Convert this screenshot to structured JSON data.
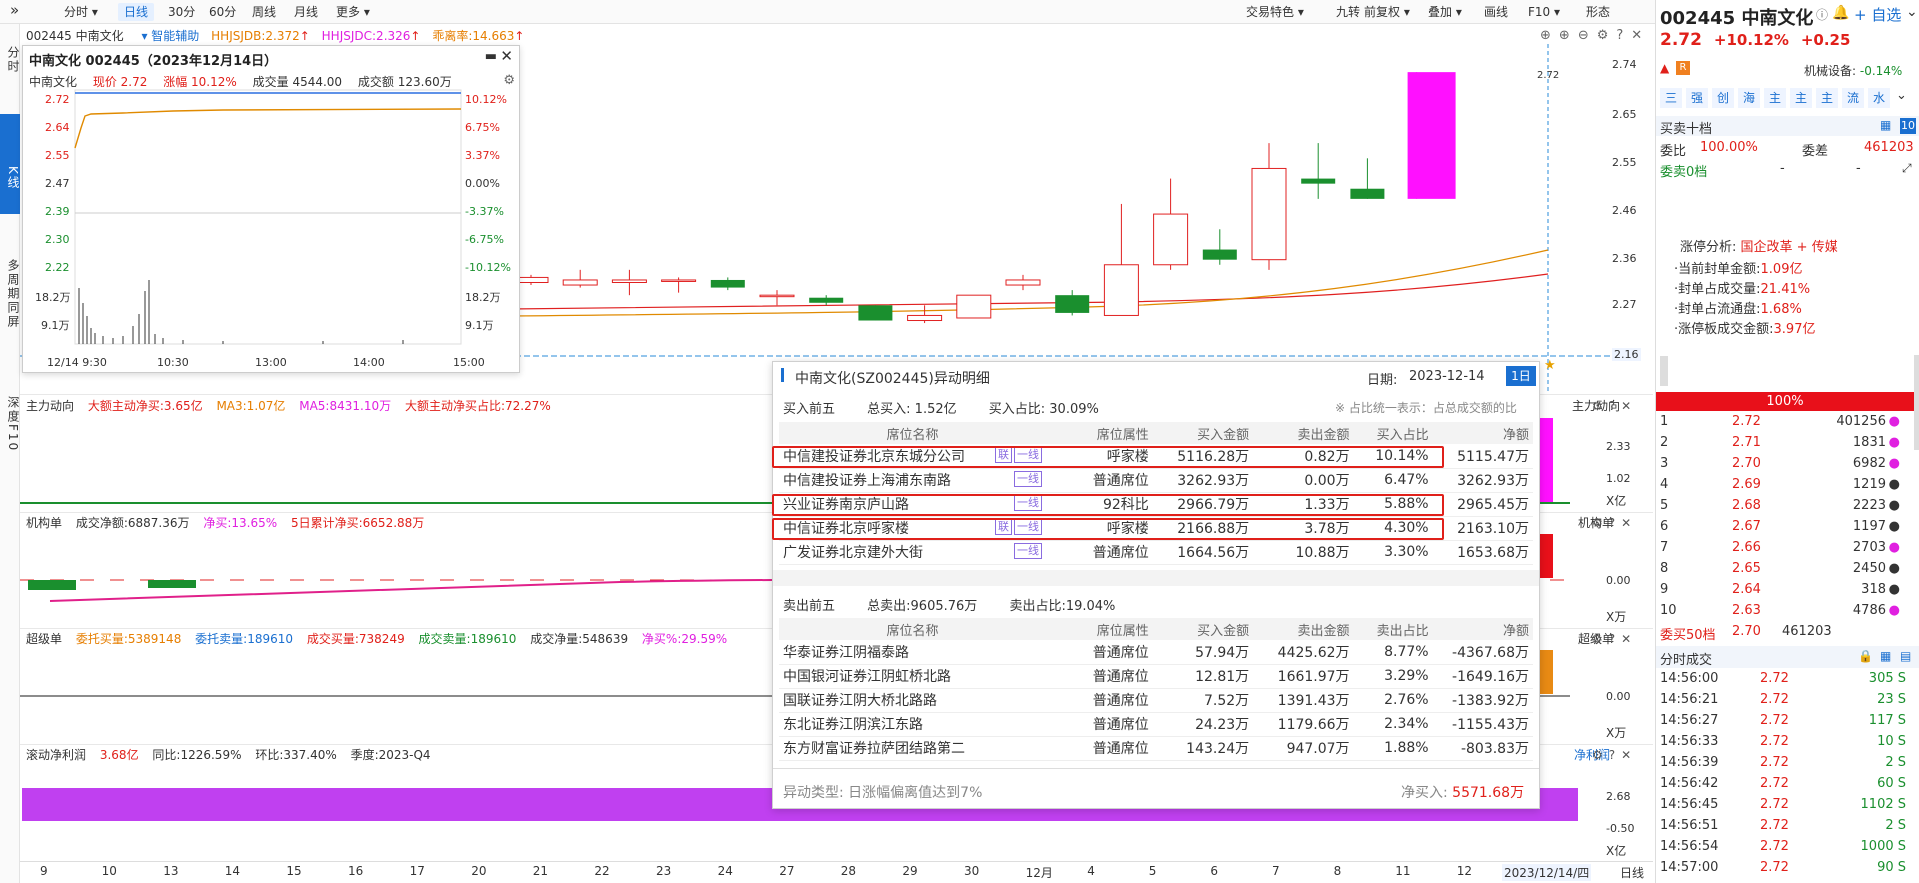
{
  "toolbar": {
    "left": [
      "分时",
      "日线",
      "30分",
      "60分",
      "周线",
      "月线",
      "更多"
    ],
    "right": [
      "交易特色",
      "九转",
      "前复权",
      "叠加",
      "画线",
      "F10",
      "形态"
    ]
  },
  "left_tabs": [
    "分时",
    "K线",
    "多周期同屏",
    "深度F10"
  ],
  "main_header": {
    "code_name": "002445 中南文化",
    "assist": "智能辅助",
    "hhjsjdb": "HHJSJDB:2.372",
    "hhjsjdc": "HHJSJDC:2.326",
    "deviation": "乖离率:14.663"
  },
  "price_axis": [
    "2.74",
    "2.65",
    "2.55",
    "2.46",
    "2.36",
    "2.27",
    "2.16"
  ],
  "last_price_label": "2.72",
  "x_axis": [
    "9",
    "10",
    "13",
    "14",
    "15",
    "16",
    "17",
    "20",
    "21",
    "22",
    "23",
    "24",
    "27",
    "28",
    "29",
    "30",
    "12月",
    "4",
    "5",
    "6",
    "7",
    "8",
    "11",
    "12"
  ],
  "x_axis_current": "2023/12/14/四",
  "x_axis_period": "日线",
  "mini_chart": {
    "title": "中南文化 002445（2023年12月14日）",
    "name": "中南文化",
    "price": "现价 2.72",
    "change": "涨幅 10.12%",
    "volume": "成交量 4544.00",
    "amount": "成交额 123.60万",
    "left_axis": [
      "2.72",
      "2.64",
      "2.55",
      "2.47",
      "2.39",
      "2.30",
      "2.22",
      "18.2万",
      "9.1万"
    ],
    "right_axis": [
      "10.12%",
      "6.75%",
      "3.37%",
      "0.00%",
      "-3.37%",
      "-6.75%",
      "-10.12%",
      "18.2万",
      "9.1万"
    ],
    "time_axis": [
      "12/14 9:30",
      "10:30",
      "13:00",
      "14:00",
      "15:00"
    ]
  },
  "indicators": {
    "main_force": {
      "label": "主力动向",
      "a": "大额主动净买:3.65亿",
      "b": "MA3:1.07亿",
      "c": "MA5:8431.10万",
      "d": "大额主动净买占比:72.27%",
      "axis": [
        "2.33",
        "1.02",
        "X亿"
      ],
      "side": "主力动向"
    },
    "institution": {
      "label": "机构单",
      "a": "成交净额:6887.36万",
      "b": "净买:13.65%",
      "c": "5日累计净买:6652.88万",
      "axis": [
        "0.00",
        "X万"
      ],
      "side": "机构单"
    },
    "super": {
      "label": "超级单",
      "a": "委托买量:5389148",
      "b": "委托卖量:189610",
      "c": "成交买量:738249",
      "d": "成交卖量:189610",
      "e": "成交净量:548639",
      "f": "净买%:29.59%",
      "axis": [
        "0.00",
        "X万"
      ],
      "side": "超级单"
    },
    "profit": {
      "label": "滚动净利润",
      "a": "3.68亿",
      "b": "同比:1226.59%",
      "c": "环比:337.40%",
      "d": "季度:2023-Q4",
      "axis": [
        "2.68",
        "-0.50",
        "X亿"
      ],
      "side": "净利润"
    }
  },
  "detail": {
    "title": "中南文化(SZ002445)异动明细",
    "date_label": "日期:",
    "date": "2023-12-14",
    "period_btn": "1日",
    "buy_header": {
      "title": "买入前五",
      "total": "总买入: 1.52亿",
      "ratio": "买入占比: 30.09%",
      "note": "※ 占比统一表示：占总成交额的比"
    },
    "columns": [
      "席位名称",
      "席位属性",
      "买入金额",
      "卖出金额",
      "买入占比",
      "净额"
    ],
    "sell_columns": [
      "席位名称",
      "席位属性",
      "买入金额",
      "卖出金额",
      "卖出占比",
      "净额"
    ],
    "buy_rows": [
      {
        "name": "中信建投证券北京东城分公司",
        "tags": [
          "联",
          "一线"
        ],
        "attr": "呼家楼",
        "buy": "5116.28万",
        "sell": "0.82万",
        "ratio": "10.14%",
        "net": "5115.47万"
      },
      {
        "name": "中信建投证券上海浦东南路",
        "tags": [
          "一线"
        ],
        "attr": "普通席位",
        "buy": "3262.93万",
        "sell": "0.00万",
        "ratio": "6.47%",
        "net": "3262.93万"
      },
      {
        "name": "兴业证券南京庐山路",
        "tags": [
          "一线"
        ],
        "attr": "92科比",
        "buy": "2966.79万",
        "sell": "1.33万",
        "ratio": "5.88%",
        "net": "2965.45万"
      },
      {
        "name": "中信证券北京呼家楼",
        "tags": [
          "联",
          "一线"
        ],
        "attr": "呼家楼",
        "buy": "2166.88万",
        "sell": "3.78万",
        "ratio": "4.30%",
        "net": "2163.10万"
      },
      {
        "name": "广发证券北京建外大街",
        "tags": [
          "一线"
        ],
        "attr": "普通席位",
        "buy": "1664.56万",
        "sell": "10.88万",
        "ratio": "3.30%",
        "net": "1653.68万"
      }
    ],
    "sell_header": {
      "title": "卖出前五",
      "total": "总卖出:9605.76万",
      "ratio": "卖出占比:19.04%"
    },
    "sell_rows": [
      {
        "name": "华泰证券江阴福泰路",
        "attr": "普通席位",
        "buy": "57.94万",
        "sell": "4425.62万",
        "ratio": "8.77%",
        "net": "-4367.68万"
      },
      {
        "name": "中国银河证券江阴虹桥北路",
        "attr": "普通席位",
        "buy": "12.81万",
        "sell": "1661.97万",
        "ratio": "3.29%",
        "net": "-1649.16万"
      },
      {
        "name": "国联证券江阴大桥北路路",
        "attr": "普通席位",
        "buy": "7.52万",
        "sell": "1391.43万",
        "ratio": "2.76%",
        "net": "-1383.92万"
      },
      {
        "name": "东北证券江阴滨江东路",
        "attr": "普通席位",
        "buy": "24.23万",
        "sell": "1179.66万",
        "ratio": "2.34%",
        "net": "-1155.43万"
      },
      {
        "name": "东方财富证券拉萨团结路第二",
        "attr": "普通席位",
        "buy": "143.24万",
        "sell": "947.07万",
        "ratio": "1.88%",
        "net": "-803.83万"
      }
    ],
    "footer_type": "异动类型: 日涨幅偏离值达到7%",
    "footer_net_label": "净买入:",
    "footer_net": "5571.68万"
  },
  "right_panel": {
    "code": "002445",
    "name": "中南文化",
    "add_btn": "自选",
    "price": "2.72",
    "change_pct": "+10.12%",
    "change_amt": "+0.25",
    "badge_r": "R",
    "mech_label": "机械设备:",
    "mech_val": "-0.14%",
    "tabs": [
      "三",
      "强",
      "创",
      "海",
      "主",
      "主",
      "主",
      "流",
      "水"
    ],
    "book_title": "买卖十档",
    "book_btn": "10",
    "wb_label": "委比",
    "wb_val": "100.00%",
    "wc_label": "委差",
    "wc_val": "461203",
    "sell0": "委卖0档",
    "sell0_a": "-",
    "sell0_b": "-",
    "zt_label": "涨停分析:",
    "zt_reason": "国企改革 + 传媒",
    "zt_lines": [
      {
        "k": "·当前封单金额:",
        "v": "1.09亿"
      },
      {
        "k": "·封单占成交量:",
        "v": "21.41%"
      },
      {
        "k": "·封单占流通盘:",
        "v": "1.68%"
      },
      {
        "k": "·涨停板成交金额:",
        "v": "3.97亿"
      }
    ],
    "bar_label": "100%",
    "bids": [
      {
        "lvl": "1",
        "p": "2.72",
        "v": "401256",
        "c": "#e020e0"
      },
      {
        "lvl": "2",
        "p": "2.71",
        "v": "1831",
        "c": "#e020e0"
      },
      {
        "lvl": "3",
        "p": "2.70",
        "v": "6982",
        "c": "#e020e0"
      },
      {
        "lvl": "4",
        "p": "2.69",
        "v": "1219",
        "c": "#333333"
      },
      {
        "lvl": "5",
        "p": "2.68",
        "v": "2223",
        "c": "#333333"
      },
      {
        "lvl": "6",
        "p": "2.67",
        "v": "1197",
        "c": "#333333"
      },
      {
        "lvl": "7",
        "p": "2.66",
        "v": "2703",
        "c": "#e020e0"
      },
      {
        "lvl": "8",
        "p": "2.65",
        "v": "2450",
        "c": "#333333"
      },
      {
        "lvl": "9",
        "p": "2.64",
        "v": "318",
        "c": "#333333"
      },
      {
        "lvl": "10",
        "p": "2.63",
        "v": "4786",
        "c": "#e020e0"
      }
    ],
    "buy50_label": "委买50档",
    "buy50_p": "2.70",
    "buy50_v": "461203",
    "ticks_title": "分时成交",
    "ticks": [
      {
        "t": "14:56:00",
        "p": "2.72",
        "v": "305 S"
      },
      {
        "t": "14:56:21",
        "p": "2.72",
        "v": "23 S"
      },
      {
        "t": "14:56:27",
        "p": "2.72",
        "v": "117 S"
      },
      {
        "t": "14:56:33",
        "p": "2.72",
        "v": "10 S"
      },
      {
        "t": "14:56:39",
        "p": "2.72",
        "v": "2 S"
      },
      {
        "t": "14:56:42",
        "p": "2.72",
        "v": "60 S"
      },
      {
        "t": "14:56:45",
        "p": "2.72",
        "v": "1102 S"
      },
      {
        "t": "14:56:51",
        "p": "2.72",
        "v": "2 S"
      },
      {
        "t": "14:56:54",
        "p": "2.72",
        "v": "1000 S"
      },
      {
        "t": "14:57:00",
        "p": "2.72",
        "v": "90 S"
      }
    ]
  },
  "candles": [
    {
      "o": 2.305,
      "c": 2.315,
      "h": 2.32,
      "l": 2.3
    },
    {
      "o": 2.3,
      "c": 2.31,
      "h": 2.33,
      "l": 2.295
    },
    {
      "o": 2.305,
      "c": 2.31,
      "h": 2.33,
      "l": 2.28
    },
    {
      "o": 2.31,
      "c": 2.31,
      "h": 2.315,
      "l": 2.285
    },
    {
      "o": 2.31,
      "c": 2.295,
      "h": 2.315,
      "l": 2.29
    },
    {
      "o": 2.28,
      "c": 2.28,
      "h": 2.29,
      "l": 2.26
    },
    {
      "o": 2.275,
      "c": 2.265,
      "h": 2.28,
      "l": 2.26
    },
    {
      "o": 2.26,
      "c": 2.23,
      "h": 2.26,
      "l": 2.23
    },
    {
      "o": 2.23,
      "c": 2.24,
      "h": 2.26,
      "l": 2.225
    },
    {
      "o": 2.235,
      "c": 2.28,
      "h": 2.28,
      "l": 2.235
    },
    {
      "o": 2.3,
      "c": 2.31,
      "h": 2.32,
      "l": 2.29
    },
    {
      "o": 2.28,
      "c": 2.245,
      "h": 2.29,
      "l": 2.24
    },
    {
      "o": 2.24,
      "c": 2.34,
      "h": 2.46,
      "l": 2.24
    },
    {
      "o": 2.34,
      "c": 2.44,
      "h": 2.51,
      "l": 2.33
    },
    {
      "o": 2.37,
      "c": 2.35,
      "h": 2.41,
      "l": 2.34
    },
    {
      "o": 2.35,
      "c": 2.53,
      "h": 2.58,
      "l": 2.33
    },
    {
      "o": 2.51,
      "c": 2.5,
      "h": 2.58,
      "l": 2.47
    },
    {
      "o": 2.49,
      "c": 2.47,
      "h": 2.55,
      "l": 2.47
    },
    {
      "o": 2.47,
      "c": 2.72,
      "h": 2.72,
      "l": 2.47
    }
  ]
}
